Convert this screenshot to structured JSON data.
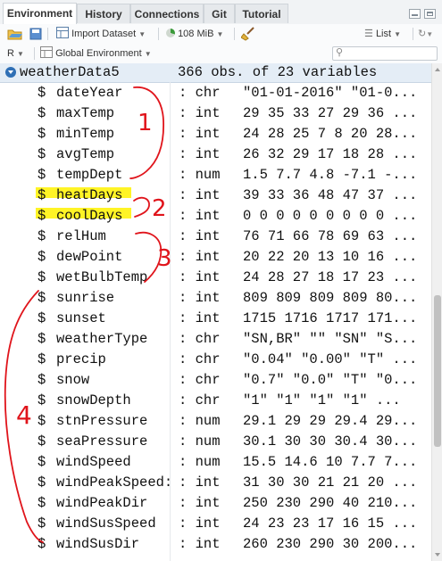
{
  "tabs": [
    {
      "label": "Environment"
    },
    {
      "label": "History"
    },
    {
      "label": "Connections"
    },
    {
      "label": "Git"
    },
    {
      "label": "Tutorial"
    }
  ],
  "toolbar": {
    "import_label": "Import Dataset",
    "memory_label": "108 MiB",
    "list_label": "List"
  },
  "toolbar2": {
    "lang_label": "R",
    "env_label": "Global Environment"
  },
  "dataset": {
    "name": "weatherData5",
    "desc": "366 obs. of 23 variables"
  },
  "variables": [
    {
      "name": "dateYear",
      "type": "chr",
      "value": "\"01-01-2016\" \"01-0..."
    },
    {
      "name": "maxTemp",
      "type": "int",
      "value": "29 35 33 27 29 36 ..."
    },
    {
      "name": "minTemp",
      "type": "int",
      "value": "24 28 25 7 8 20 28..."
    },
    {
      "name": "avgTemp",
      "type": "int",
      "value": "26 32 29 17 18 28 ..."
    },
    {
      "name": "tempDept",
      "type": "num",
      "value": "1.5 7.7 4.8 -7.1 -..."
    },
    {
      "name": "heatDays",
      "type": "int",
      "value": "39 33 36 48 47 37 ..."
    },
    {
      "name": "coolDays",
      "type": "int",
      "value": "0 0 0 0 0 0 0 0 0 ..."
    },
    {
      "name": "relHum",
      "type": "int",
      "value": "76 71 66 78 69 63 ..."
    },
    {
      "name": "dewPoint",
      "type": "int",
      "value": "20 22 20 13 10 16 ..."
    },
    {
      "name": "wetBulbTemp",
      "type": "int",
      "value": "24 28 27 18 17 23 ..."
    },
    {
      "name": "sunrise",
      "type": "int",
      "value": "809 809 809 809 80..."
    },
    {
      "name": "sunset",
      "type": "int",
      "value": "1715 1716 1717 171..."
    },
    {
      "name": "weatherType",
      "type": "chr",
      "value": "\"SN,BR\" \"\" \"SN\" \"S..."
    },
    {
      "name": "precip",
      "type": "chr",
      "value": "\"0.04\" \"0.00\" \"T\" ..."
    },
    {
      "name": "snow",
      "type": "chr",
      "value": "\"0.7\" \"0.0\" \"T\" \"0..."
    },
    {
      "name": "snowDepth",
      "type": "chr",
      "value": "\"1\" \"1\" \"1\" \"1\" ..."
    },
    {
      "name": "stnPressure",
      "type": "num",
      "value": "29.1 29 29 29.4 29..."
    },
    {
      "name": "seaPressure",
      "type": "num",
      "value": "30.1 30 30 30.4 30..."
    },
    {
      "name": "windSpeed",
      "type": "num",
      "value": "15.5 14.6 10 7.7 7..."
    },
    {
      "name": "windPeakSpeed:",
      "type": "int",
      "value": "31 30 30 21 21 20 ..."
    },
    {
      "name": "windPeakDir",
      "type": "int",
      "value": "250 230 290 40 210..."
    },
    {
      "name": "windSusSpeed",
      "type": "int",
      "value": "24 23 23 17 16 15 ..."
    },
    {
      "name": "windSusDir",
      "type": "int",
      "value": "260 230 290 30 200..."
    }
  ],
  "annotations": {
    "group1": "1",
    "group2": "2",
    "group3": "3",
    "group4": "4"
  },
  "colors": {
    "annotation_ink": "#e0141b",
    "highlight": "#fff200",
    "header_band": "#e4edf6"
  }
}
